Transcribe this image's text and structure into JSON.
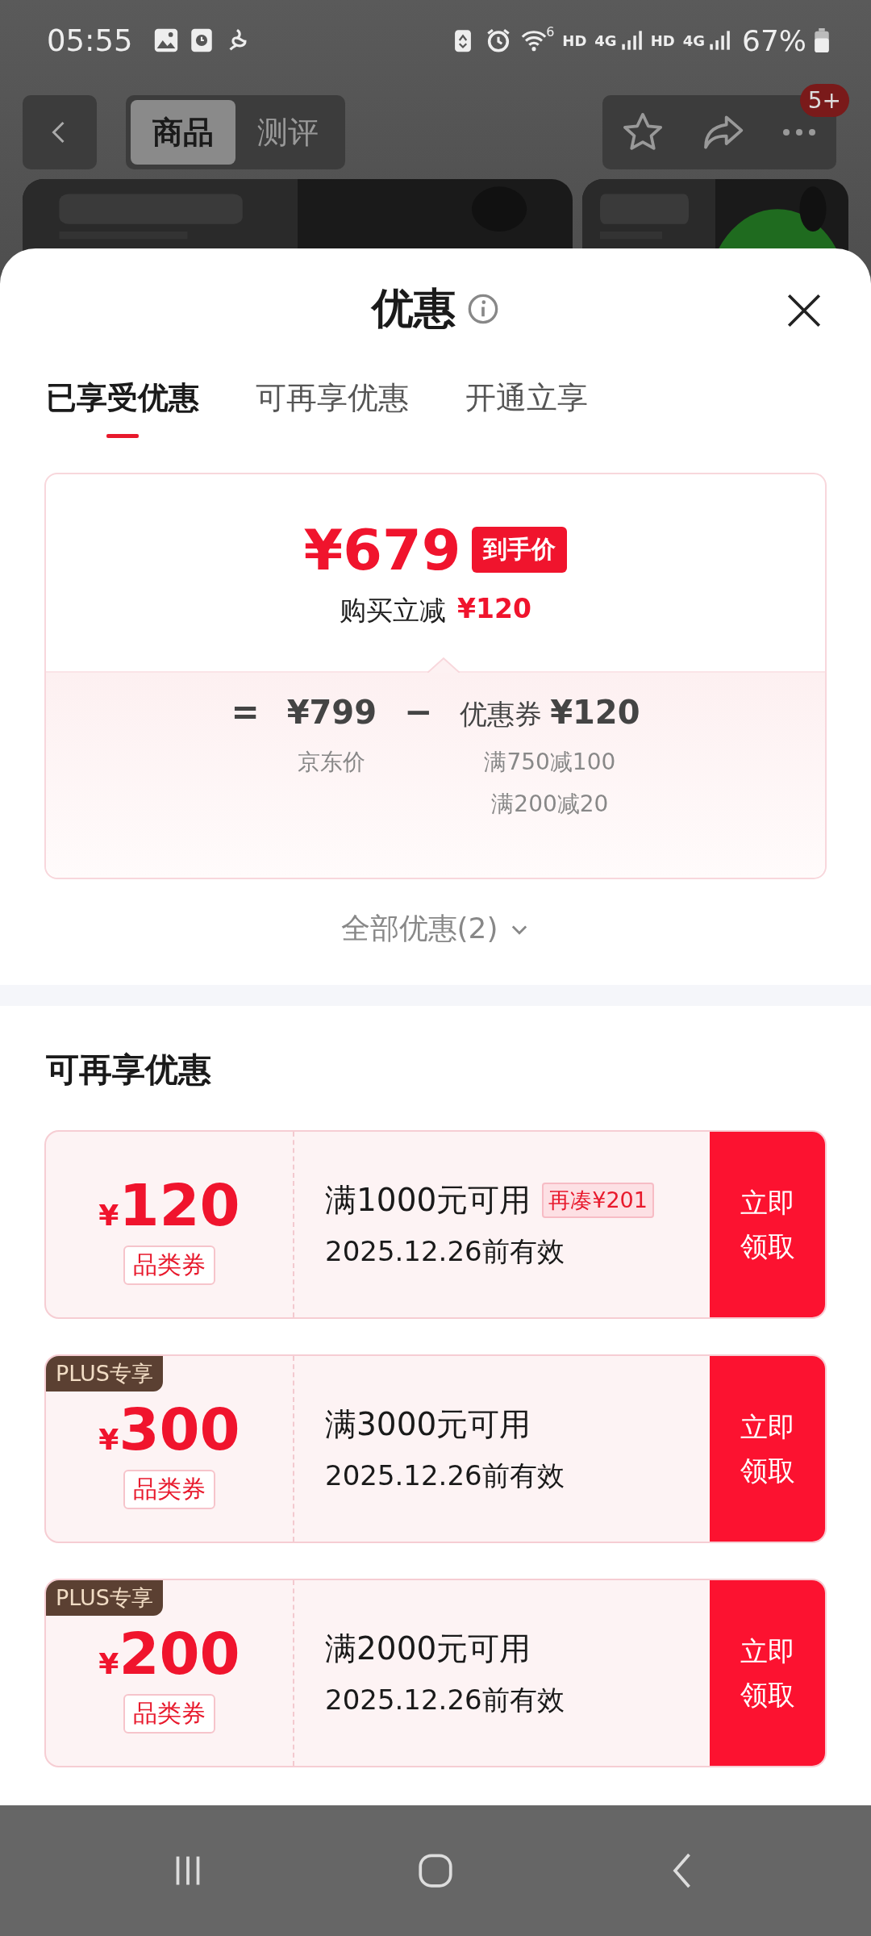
{
  "status_bar": {
    "time": "05:55",
    "wifi_label": "6",
    "network_labels": [
      "HD",
      "4G",
      "HD",
      "4G"
    ],
    "battery": "67%"
  },
  "top_nav": {
    "tabs": [
      {
        "label": "商品",
        "selected": true
      },
      {
        "label": "测评",
        "selected": false
      }
    ],
    "badge": "5+"
  },
  "sheet": {
    "title": "优惠",
    "tabs": [
      {
        "label": "已享受优惠",
        "selected": true
      },
      {
        "label": "可再享优惠",
        "selected": false
      },
      {
        "label": "开通立享",
        "selected": false
      }
    ],
    "price_card": {
      "final_price": "¥679",
      "final_tag": "到手价",
      "saving_label": "购买立减",
      "saving": "¥120",
      "equals": "=",
      "original_price": "¥799",
      "original_label": "京东价",
      "minus": "−",
      "coupon_label": "优惠券",
      "coupon_amount": "¥120",
      "coupon_rules": [
        "满750减100",
        "满200减20"
      ]
    },
    "all_offers": "全部优惠(2)",
    "section_title": "可再享优惠",
    "coupons": [
      {
        "currency": "¥",
        "amount": "120",
        "type": "品类券",
        "condition": "满1000元可用",
        "hint": "再凑¥201",
        "validity": "2025.12.26前有效",
        "button": "立即领取"
      },
      {
        "plus_tag": "PLUS专享",
        "currency": "¥",
        "amount": "300",
        "type": "品类券",
        "condition": "满3000元可用",
        "validity": "2025.12.26前有效",
        "button": "立即领取"
      },
      {
        "plus_tag": "PLUS专享",
        "currency": "¥",
        "amount": "200",
        "type": "品类券",
        "condition": "满2000元可用",
        "validity": "2025.12.26前有效",
        "button": "立即领取"
      }
    ]
  }
}
